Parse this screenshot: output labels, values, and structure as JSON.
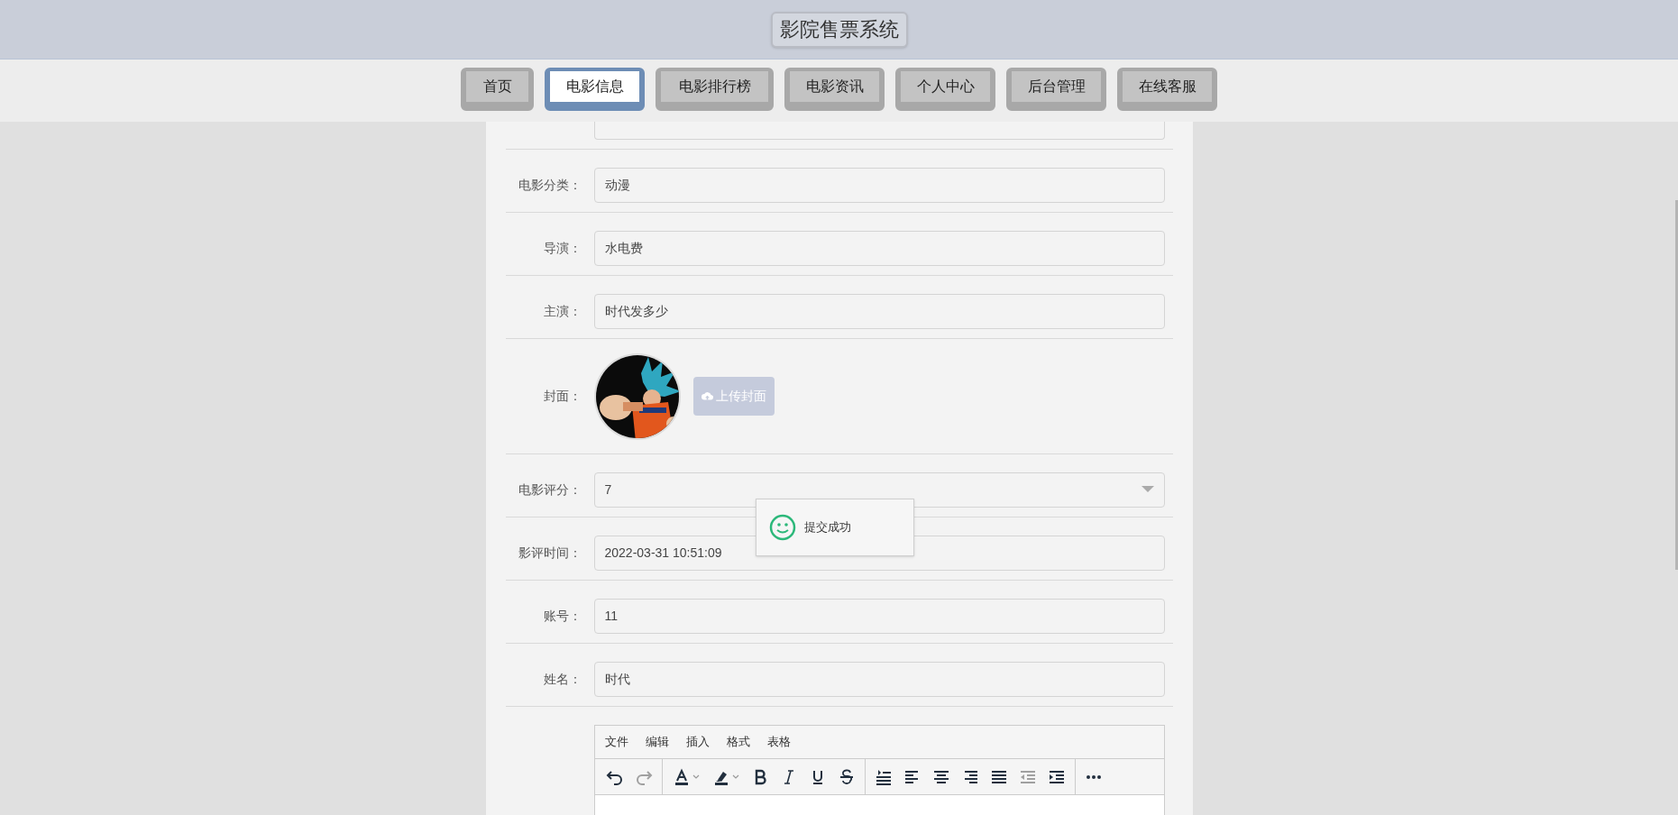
{
  "header": {
    "title": "影院售票系统"
  },
  "nav": [
    {
      "label": "首页",
      "selected": false
    },
    {
      "label": "电影信息",
      "selected": true
    },
    {
      "label": "电影排行榜",
      "selected": false
    },
    {
      "label": "电影资讯",
      "selected": false
    },
    {
      "label": "个人中心",
      "selected": false
    },
    {
      "label": "后台管理",
      "selected": false
    },
    {
      "label": "在线客服",
      "selected": false
    }
  ],
  "form": {
    "fields": [
      {
        "kind": "text",
        "label": "电影分类：",
        "value": "动漫"
      },
      {
        "kind": "text",
        "label": "导演：",
        "value": "水电费"
      },
      {
        "kind": "text",
        "label": "主演：",
        "value": "时代发多少"
      },
      {
        "label": "封面：",
        "button": "上传封面"
      },
      {
        "kind": "select",
        "label": "电影评分：",
        "value": "7"
      },
      {
        "kind": "text",
        "label": "影评时间：",
        "value": "2022-03-31 10:51:09"
      },
      {
        "kind": "text",
        "label": "账号：",
        "value": "11"
      },
      {
        "kind": "text",
        "label": "姓名：",
        "value": "时代"
      }
    ]
  },
  "editor": {
    "menu": [
      "文件",
      "编辑",
      "插入",
      "格式",
      "表格"
    ],
    "toolbar": [
      {
        "kind": "undo",
        "disabled": false
      },
      {
        "kind": "redo",
        "disabled": true
      },
      {
        "kind": "sep"
      },
      {
        "kind": "textcolor",
        "disabled": false
      },
      {
        "kind": "highlight",
        "disabled": false
      },
      {
        "kind": "bold",
        "disabled": false
      },
      {
        "kind": "italic",
        "disabled": false
      },
      {
        "kind": "underline",
        "disabled": false
      },
      {
        "kind": "strike",
        "disabled": false
      },
      {
        "kind": "sep"
      },
      {
        "kind": "lineheight",
        "disabled": false
      },
      {
        "kind": "alignleft",
        "disabled": false
      },
      {
        "kind": "aligncenter",
        "disabled": false
      },
      {
        "kind": "alignright",
        "disabled": false
      },
      {
        "kind": "justify",
        "disabled": false
      },
      {
        "kind": "outdent",
        "disabled": true
      },
      {
        "kind": "indent",
        "disabled": false
      },
      {
        "kind": "sep"
      },
      {
        "kind": "more",
        "disabled": false
      }
    ]
  },
  "toast": {
    "message": "提交成功"
  }
}
